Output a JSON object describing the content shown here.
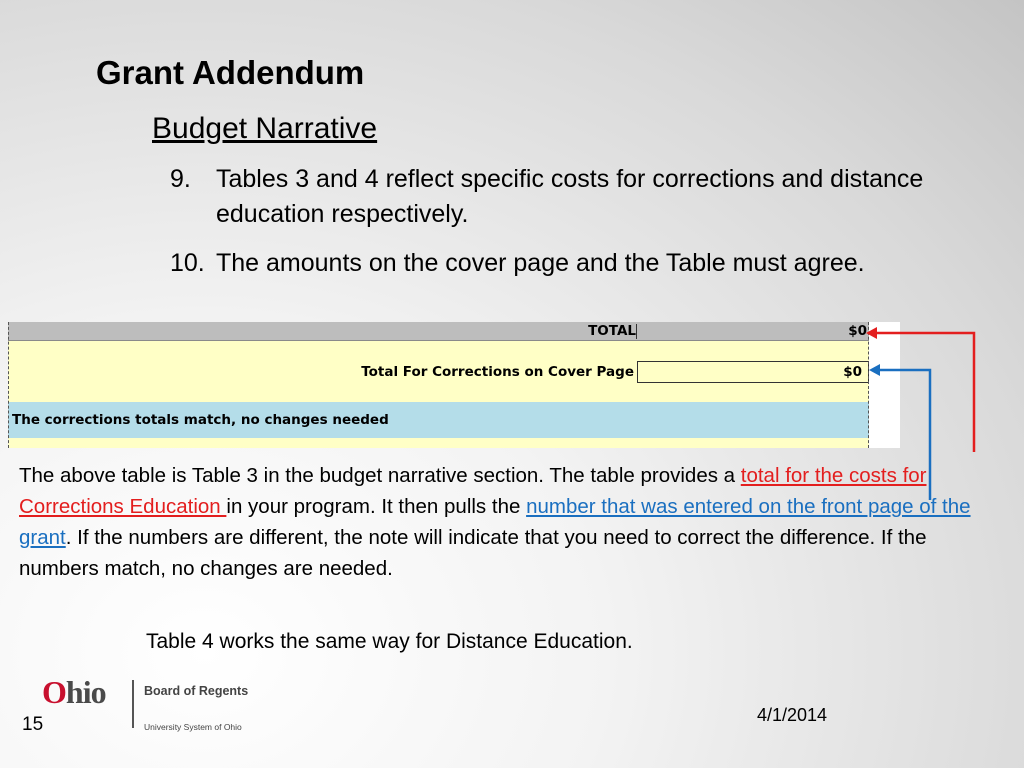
{
  "slide": {
    "title": "Grant Addendum",
    "subtitle": "Budget Narrative",
    "items": [
      {
        "number": "9.",
        "text": "Tables 3 and 4 reflect specific costs for corrections and distance education respectively."
      },
      {
        "number": "10.",
        "text": "The amounts on the cover page and the Table must agree."
      }
    ]
  },
  "spreadsheet": {
    "total_label": "TOTAL",
    "total_value": "$0",
    "cover_label": "Total For Corrections on Cover Page",
    "cover_value": "$0",
    "status_message": "The corrections totals match, no changes needed"
  },
  "paragraph": {
    "part1": "The above table is Table 3 in the budget narrative section. The table provides a ",
    "red_link": "total for the costs for Corrections Education ",
    "part2": "in your program. It then pulls the ",
    "blue_link": "number that was entered on the front page of the grant",
    "part3": ". If the numbers are different, the note will indicate that you need to correct the difference. If the numbers match,  no changes are needed."
  },
  "table4_note": "Table 4 works the same way for Distance Education.",
  "footer": {
    "logo_prefix": "O",
    "logo_rest": "hio",
    "logo_board": "Board of Regents",
    "logo_system": "University System of Ohio",
    "date": "4/1/2014",
    "page_number": "15"
  },
  "colors": {
    "red_arrow": "#e31e1e",
    "blue_arrow": "#1a6fc0",
    "sheet_yellow": "#ffffc6",
    "sheet_blue": "#b4dde9",
    "sheet_gray": "#bdbdbd"
  },
  "icons": [
    "red-arrow-icon",
    "blue-arrow-icon",
    "ohio-logo"
  ]
}
